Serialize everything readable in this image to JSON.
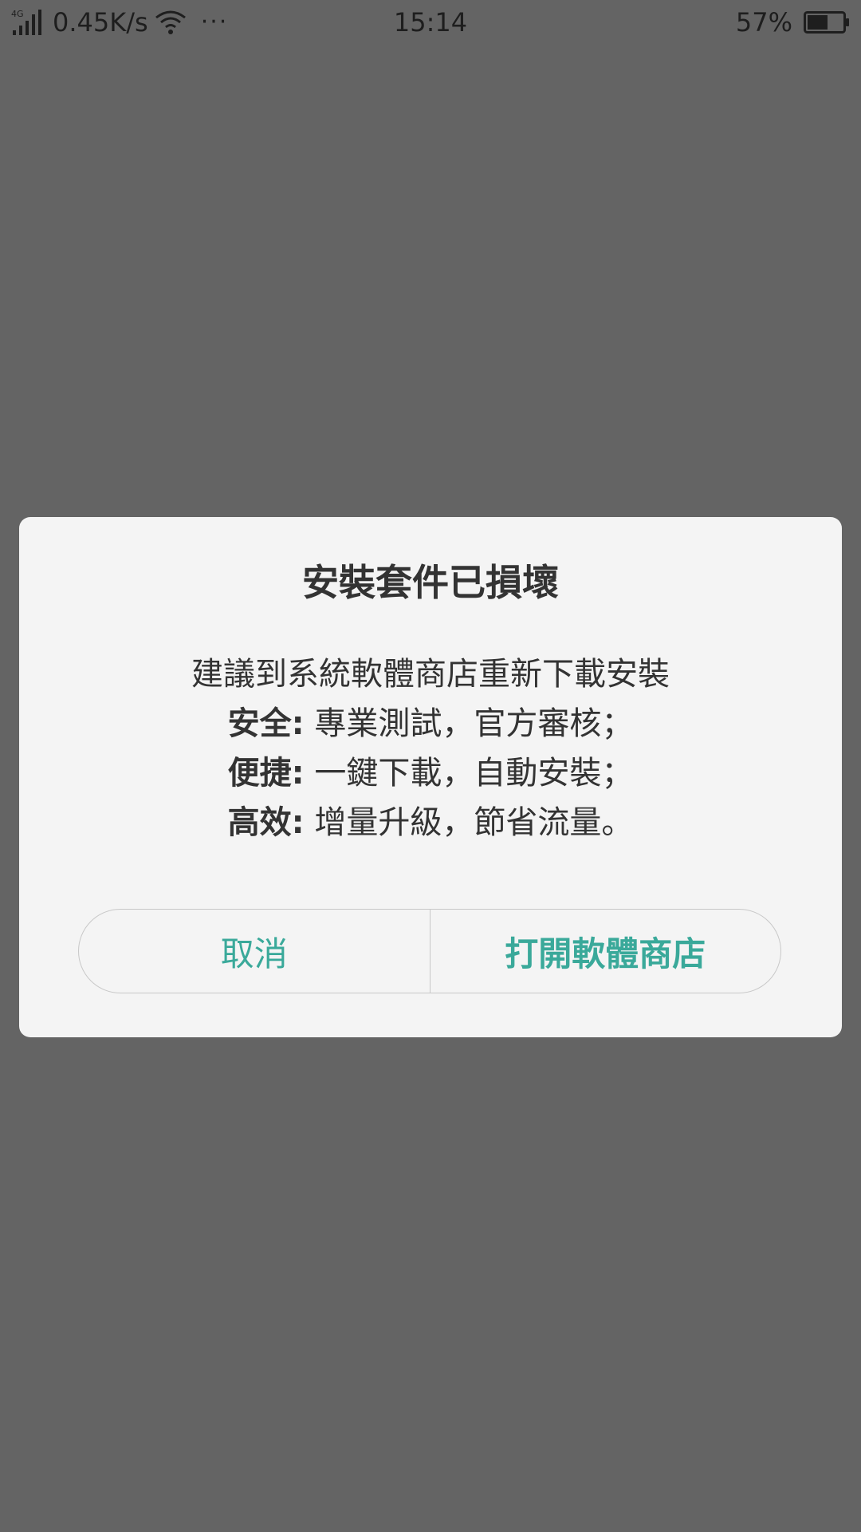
{
  "status_bar": {
    "network_type": "4G",
    "speed": "0.45K/s",
    "more": "···",
    "time": "15:14",
    "battery_percent": "57%",
    "battery_level": 0.57,
    "icons": [
      "signal-icon",
      "wifi-icon",
      "more-icon",
      "battery-icon"
    ]
  },
  "dialog": {
    "title": "安裝套件已損壞",
    "subtitle": "建議到系統軟體商店重新下載安裝",
    "features": [
      {
        "key": "安全:",
        "value": "專業測試，官方審核；"
      },
      {
        "key": "便捷:",
        "value": "一鍵下載，自動安裝；"
      },
      {
        "key": "高效:",
        "value": "增量升級，節省流量。"
      }
    ],
    "buttons": {
      "cancel": "取消",
      "open_store": "打開軟體商店"
    }
  },
  "colors": {
    "overlay": "#646464",
    "dialog_bg": "#f4f4f4",
    "accent": "#3aa99a",
    "text": "#333333"
  }
}
